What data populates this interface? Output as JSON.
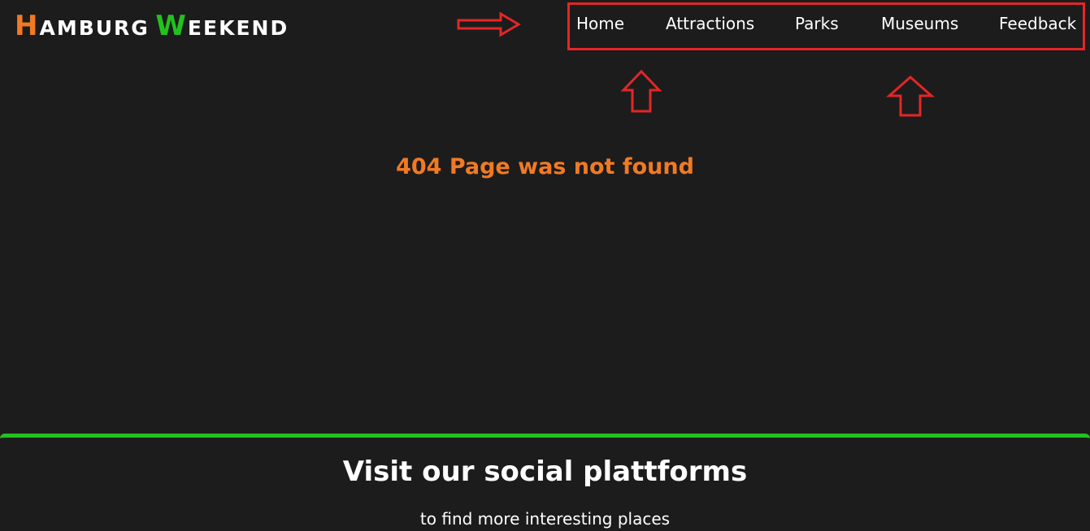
{
  "logo": {
    "first_initial": "H",
    "first_rest": "AMBURG",
    "second_initial": "W",
    "second_rest": "EEKEND"
  },
  "nav": {
    "items": [
      {
        "label": "Home"
      },
      {
        "label": "Attractions"
      },
      {
        "label": "Parks"
      },
      {
        "label": "Museums"
      },
      {
        "label": "Feedback"
      }
    ]
  },
  "main": {
    "error_message": "404 Page was not found"
  },
  "footer": {
    "title": "Visit our social plattforms",
    "subtitle": "to find more interesting places"
  },
  "colors": {
    "background": "#1c1c1c",
    "accent_orange": "#f07a24",
    "accent_green": "#22c21e",
    "annotation_red": "#e32626",
    "text": "#ffffff"
  },
  "icons": {
    "annotation_arrow_right": "right-arrow-icon",
    "annotation_arrow_up": "up-arrow-icon"
  }
}
